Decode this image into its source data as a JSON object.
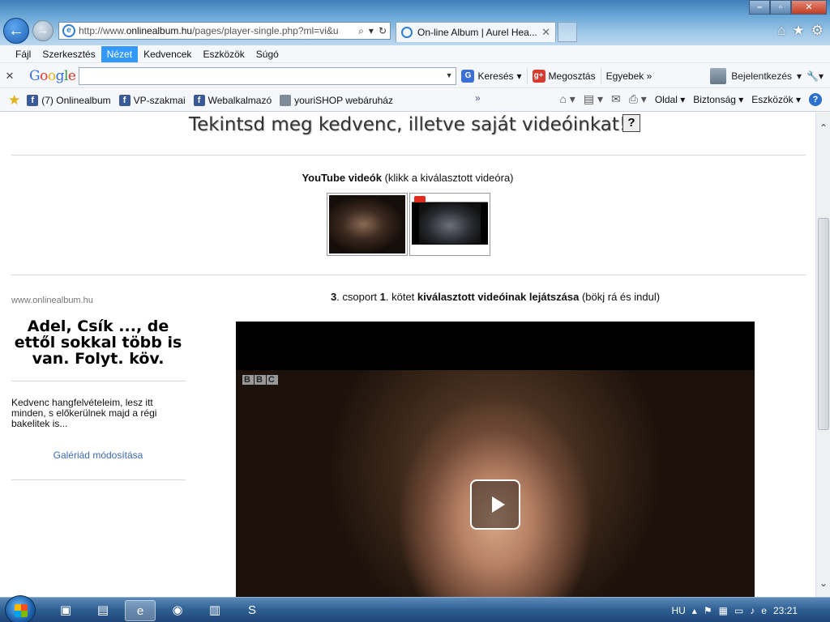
{
  "browser": {
    "url_prefix": "http://www.",
    "url_domain": "onlinealbum.hu",
    "url_suffix": "/pages/player-single.php?ml=vi&u",
    "tab_title": "On-line Album | Aurel Hea...",
    "tab_close": "✕"
  },
  "menu": {
    "items": [
      "Fájl",
      "Szerkesztés",
      "Nézet",
      "Kedvencek",
      "Eszközök",
      "Súgó"
    ],
    "active_index": 2
  },
  "google_toolbar": {
    "close": "✕",
    "logo": [
      "G",
      "o",
      "o",
      "g",
      "l",
      "e"
    ],
    "search_value": "",
    "search_label": "Keresés",
    "share_label": "Megosztás",
    "more_label": "Egyebek »",
    "login_label": "Bejelentkezés"
  },
  "favorites": {
    "items": [
      "(7) Onlinealbum",
      "VP-szakmai",
      "Webalkalmazó",
      "youriSHOP webáruház"
    ],
    "overflow": "»"
  },
  "command_bar": {
    "page": "Oldal",
    "security": "Biztonság",
    "tools": "Eszközök"
  },
  "page": {
    "heading": "Tekintsd meg kedvenc, illetve saját videóinkat!",
    "help_symbol": "?",
    "youtube_title_bold": "YouTube videók",
    "youtube_title_rest": " (klikk a kiválasztott videóra)",
    "site_name": "www.onlinealbum.hu",
    "side_title": "Adel, Csík ..., de ettől sokkal több is van. Folyt. köv.",
    "side_description": "Kedvenc hangfelvételeim, lesz itt minden, s előkerülnek majd a régi bakelitek is...",
    "gallery_link": "Galériád módosítása",
    "caption_num1": "3",
    "caption_text1": ". csoport ",
    "caption_num2": "1",
    "caption_text2": ". kötet ",
    "caption_bold": "kiválasztott videóinak lejátszása",
    "caption_rest": " (bökj rá és indul)",
    "player_logo": [
      "B",
      "B",
      "C"
    ]
  },
  "taskbar": {
    "language": "HU",
    "time": "23:21"
  },
  "colors": {
    "menu_active": "#3399ff",
    "link": "#3c6ab0",
    "facebook": "#3b5998"
  }
}
